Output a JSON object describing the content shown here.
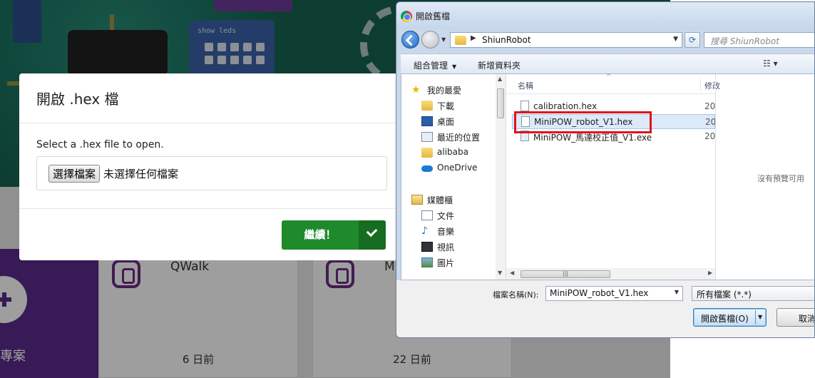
{
  "background_app": {
    "blocks_label": "show leds",
    "new_project_label": "專案",
    "projects": [
      {
        "title": "QWalk",
        "time": "6 日前"
      },
      {
        "title": "M",
        "time": "22 日前"
      }
    ]
  },
  "modal": {
    "title": "開啟 .hex 檔",
    "prompt": "Select a .hex file to open.",
    "file_button": "選擇檔案",
    "file_status": "未選擇任何檔案",
    "continue_label": "繼續！"
  },
  "dialog": {
    "title": "開啟舊檔",
    "address": "ShiunRobot",
    "search_placeholder": "搜尋 ShiunRobot",
    "toolbar": {
      "organize": "組合管理",
      "new_folder": "新增資料夾",
      "view_icon": "view-options-icon"
    },
    "nav": [
      {
        "label": "我的最愛",
        "icon": "favorites-star-icon"
      },
      {
        "label": "下載",
        "icon": "downloads-folder-icon"
      },
      {
        "label": "桌面",
        "icon": "desktop-icon"
      },
      {
        "label": "最近的位置",
        "icon": "recent-places-icon"
      },
      {
        "label": "alibaba",
        "icon": "folder-icon"
      },
      {
        "label": "OneDrive",
        "icon": "onedrive-cloud-icon"
      },
      {
        "label": "媒體櫃",
        "icon": "libraries-icon"
      },
      {
        "label": "文件",
        "icon": "documents-icon"
      },
      {
        "label": "音樂",
        "icon": "music-icon"
      },
      {
        "label": "視訊",
        "icon": "video-icon"
      },
      {
        "label": "圖片",
        "icon": "pictures-icon"
      }
    ],
    "columns": {
      "name": "名稱",
      "modified": "修改"
    },
    "files": [
      {
        "name": "calibration.hex",
        "date": "20",
        "icon": "hex-file-icon"
      },
      {
        "name": "MiniPOW_robot_V1.hex",
        "date": "20",
        "icon": "hex-file-icon",
        "selected": true
      },
      {
        "name": "MiniPOW_馬達校正值_V1.exe",
        "date": "20",
        "icon": "exe-file-icon"
      }
    ],
    "preview_text": "沒有預覽可用",
    "file_name_label": "檔案名稱(N):",
    "file_name_value": "MiniPOW_robot_V1.hex",
    "file_type": "所有檔案 (*.*)",
    "open_label": "開啟舊檔(O)",
    "cancel_label": "取消"
  },
  "colors": {
    "continue_green": "#1f8a2c",
    "highlight_red": "#e0141c",
    "selection_blue": "#dce9f8"
  }
}
